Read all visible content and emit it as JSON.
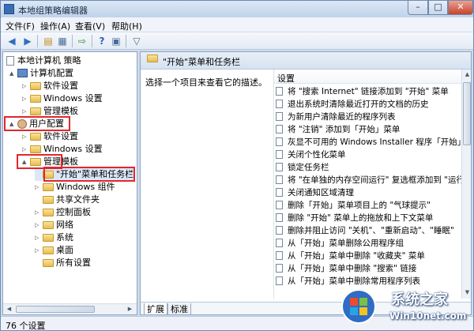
{
  "window": {
    "title": "本地组策略编辑器"
  },
  "menu": [
    "文件(F)",
    "操作(A)",
    "查看(V)",
    "帮助(H)"
  ],
  "tree": [
    {
      "label": "本地计算机 策略",
      "icon": "doc-icon",
      "arrow": "",
      "level": 0
    },
    {
      "label": "计算机配置",
      "icon": "computer-icon",
      "arrow": "▲",
      "level": 1
    },
    {
      "label": "软件设置",
      "icon": "folder-icon",
      "arrow": "▷",
      "level": 2
    },
    {
      "label": "Windows 设置",
      "icon": "folder-icon",
      "arrow": "▷",
      "level": 2
    },
    {
      "label": "管理模板",
      "icon": "folder-icon",
      "arrow": "▷",
      "level": 2
    },
    {
      "label": "用户配置",
      "icon": "user-icon",
      "arrow": "▲",
      "level": 1
    },
    {
      "label": "软件设置",
      "icon": "folder-icon",
      "arrow": "▷",
      "level": 2
    },
    {
      "label": "Windows 设置",
      "icon": "folder-icon",
      "arrow": "▷",
      "level": 2
    },
    {
      "label": "管理模板",
      "icon": "folder-icon",
      "arrow": "▲",
      "level": 2
    },
    {
      "label": "\"开始\"菜单和任务栏",
      "icon": "folder-icon",
      "arrow": "",
      "level": 3
    },
    {
      "label": "Windows 组件",
      "icon": "folder-icon",
      "arrow": "▷",
      "level": 3
    },
    {
      "label": "共享文件夹",
      "icon": "folder-icon",
      "arrow": "",
      "level": 3
    },
    {
      "label": "控制面板",
      "icon": "folder-icon",
      "arrow": "▷",
      "level": 3
    },
    {
      "label": "网络",
      "icon": "folder-icon",
      "arrow": "▷",
      "level": 3
    },
    {
      "label": "系统",
      "icon": "folder-icon",
      "arrow": "▷",
      "level": 3
    },
    {
      "label": "桌面",
      "icon": "folder-icon",
      "arrow": "▷",
      "level": 3
    },
    {
      "label": "所有设置",
      "icon": "folder-icon",
      "arrow": "",
      "level": 3
    }
  ],
  "right": {
    "header": "\"开始\"菜单和任务栏",
    "description": "选择一个项目来查看它的描述。",
    "column": "设置",
    "settings": [
      "将 \"搜索 Internet\" 链接添加到 \"开始\" 菜单",
      "退出系统时清除最近打开的文档的历史",
      "为新用户清除最近的程序列表",
      "将 \"注销\" 添加到「开始」菜单",
      "灰显不可用的 Windows Installer 程序「开始」菜单",
      "关闭个性化菜单",
      "锁定任务栏",
      "将 \"在单独的内存空间运行\" 复选框添加到 \"运行\"",
      "关闭通知区域清理",
      "删除「开始」菜单项目上的 \"气球提示\"",
      "删除 \"开始\" 菜单上的拖放和上下文菜单",
      "删除并阻止访问 \"关机\"、\"重新启动\"、\"睡眠\"",
      "从「开始」菜单删除公用程序组",
      "从「开始」菜单中删除 \"收藏夹\" 菜单",
      "从「开始」菜单中删除 \"搜索\" 链接",
      "从「开始」菜单中删除常用程序列表"
    ]
  },
  "tabs": [
    "扩展",
    "标准"
  ],
  "status": "76 个设置",
  "watermark": {
    "main": "系统之家",
    "sub": "Win10net.com"
  },
  "colors": {
    "highlight_box": "#e3262d",
    "title_bar": "#bfd3ea"
  }
}
